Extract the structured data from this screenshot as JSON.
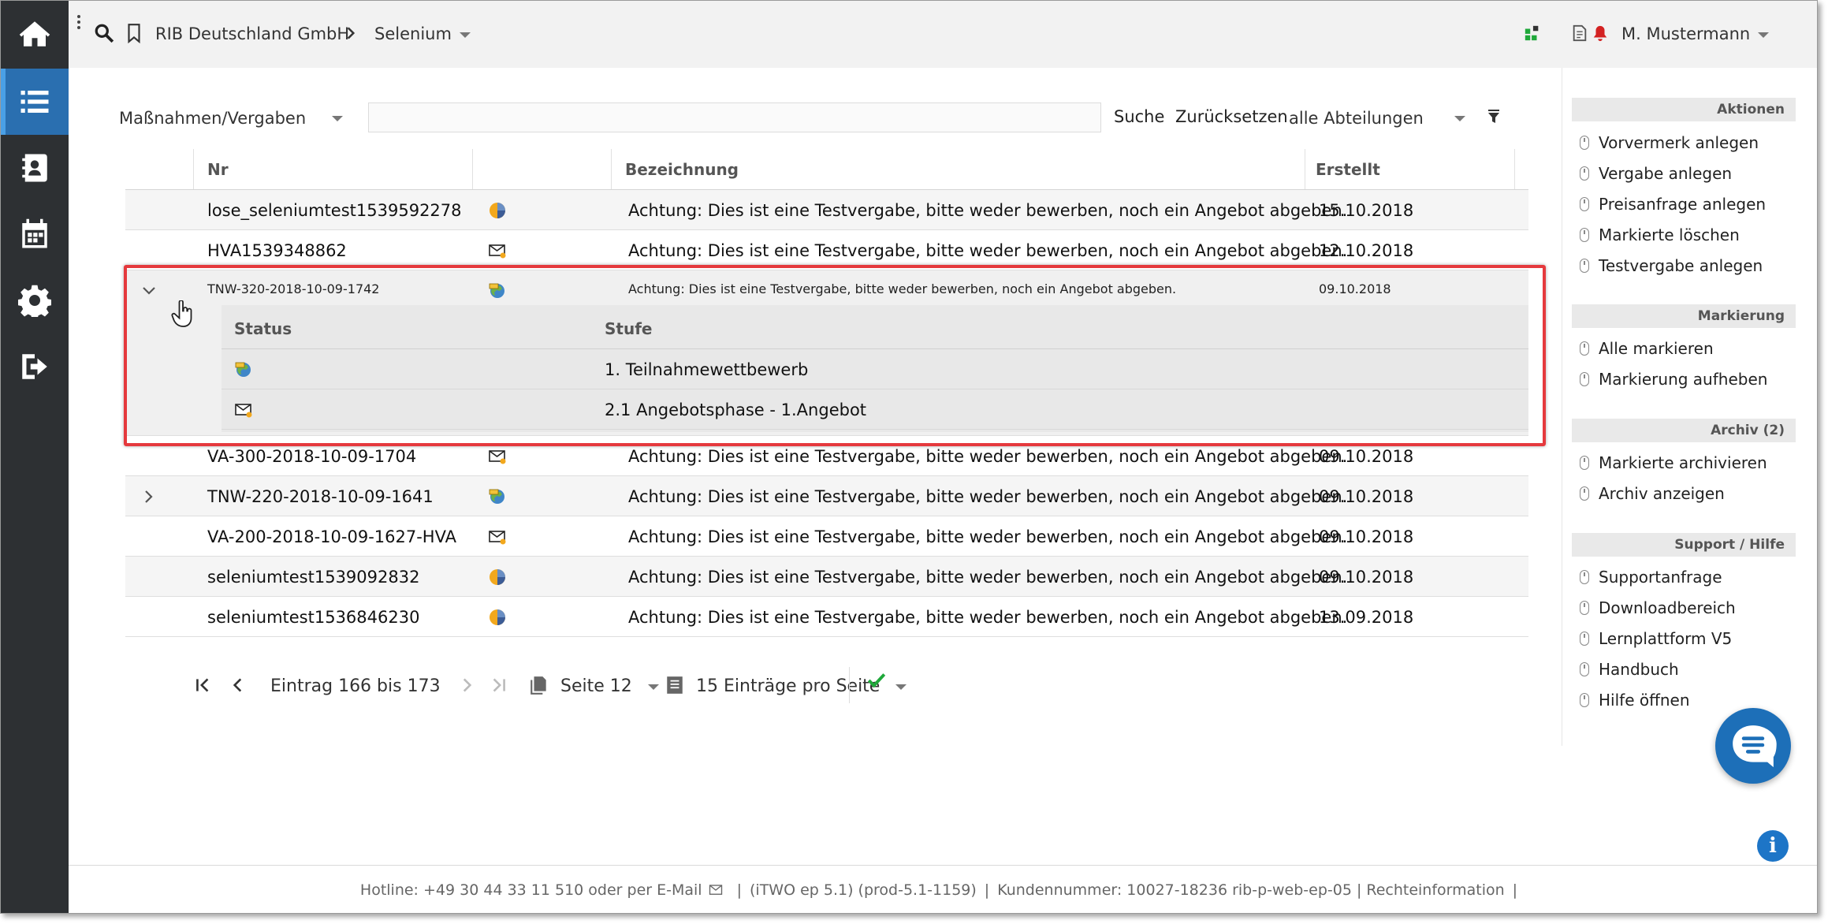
{
  "topbar": {
    "company": "RIB Deutschland GmbH",
    "project": "Selenium",
    "user": "M. Mustermann"
  },
  "filter": {
    "category": "Maßnahmen/Vergaben",
    "search_value": "",
    "search_button": "Suche",
    "reset_button": "Zurücksetzen",
    "department": "alle Abteilungen"
  },
  "table": {
    "headers": {
      "nr": "Nr",
      "bezeichnung": "Bezeichnung",
      "erstellt": "Erstellt"
    },
    "rows": [
      {
        "nr": "lose_seleniumtest1539592278",
        "status": "pie-icon",
        "bezeichnung": "Achtung: Dies ist eine Testvergabe, bitte weder bewerben, noch ein Angebot abgeben.",
        "erstellt": "15.10.2018"
      },
      {
        "nr": "HVA1539348862",
        "status": "envelope-icon",
        "bezeichnung": "Achtung: Dies ist eine Testvergabe, bitte weder bewerben, noch ein Angebot abgeben.",
        "erstellt": "12.10.2018"
      },
      {
        "nr": "TNW-320-2018-10-09-1742",
        "status": "globe-icon",
        "bezeichnung": "Achtung: Dies ist eine Testvergabe, bitte weder bewerben, noch ein Angebot abgeben.",
        "erstellt": "09.10.2018"
      },
      {
        "nr": "VA-300-2018-10-09-1704",
        "status": "envelope-icon",
        "bezeichnung": "Achtung: Dies ist eine Testvergabe, bitte weder bewerben, noch ein Angebot abgeben.",
        "erstellt": "09.10.2018"
      },
      {
        "nr": "TNW-220-2018-10-09-1641",
        "status": "globe-icon",
        "bezeichnung": "Achtung: Dies ist eine Testvergabe, bitte weder bewerben, noch ein Angebot abgeben.",
        "erstellt": "09.10.2018"
      },
      {
        "nr": "VA-200-2018-10-09-1627-HVA",
        "status": "envelope-icon",
        "bezeichnung": "Achtung: Dies ist eine Testvergabe, bitte weder bewerben, noch ein Angebot abgeben.",
        "erstellt": "09.10.2018"
      },
      {
        "nr": "seleniumtest1539092832",
        "status": "pie-icon",
        "bezeichnung": "Achtung: Dies ist eine Testvergabe, bitte weder bewerben, noch ein Angebot abgeben.",
        "erstellt": "09.10.2018"
      },
      {
        "nr": "seleniumtest1536846230",
        "status": "pie-icon",
        "bezeichnung": "Achtung: Dies ist eine Testvergabe, bitte weder bewerben, noch ein Angebot abgeben.",
        "erstellt": "13.09.2018"
      }
    ],
    "expanded": {
      "headers": {
        "status": "Status",
        "stufe": "Stufe"
      },
      "rows": [
        {
          "status": "globe-icon",
          "stufe": "1. Teilnahmewettbewerb"
        },
        {
          "status": "envelope-icon",
          "stufe": "2.1 Angebotsphase - 1.Angebot"
        }
      ]
    }
  },
  "pager": {
    "range": "Eintrag 166 bis 173",
    "page": "Seite 12",
    "per_page": "15 Einträge pro Seite"
  },
  "sidebar": {
    "sections": [
      {
        "title": "Aktionen",
        "items": [
          "Vorvermerk anlegen",
          "Vergabe anlegen",
          "Preisanfrage anlegen",
          "Markierte löschen",
          "Testvergabe anlegen"
        ]
      },
      {
        "title": "Markierung",
        "items": [
          "Alle markieren",
          "Markierung aufheben"
        ]
      },
      {
        "title": "Archiv (2)",
        "items": [
          "Markierte archivieren",
          "Archiv anzeigen"
        ]
      },
      {
        "title": "Support / Hilfe",
        "items": [
          "Supportanfrage",
          "Downloadbereich",
          "Lernplattform V5",
          "Handbuch",
          "Hilfe öffnen"
        ]
      }
    ]
  },
  "footer": {
    "hotline": "Hotline: +49 30 44 33 11 510 oder per E-Mail",
    "version": "(iTWO ep 5.1) (prod-5.1-1159)",
    "customer": "Kundennummer: 10027-18236 rib-p-web-ep-05",
    "legal": "Rechteinformation"
  },
  "colors": {
    "nav_bg": "#2d3033",
    "nav_active": "#2a6fb0",
    "highlight": "#e5393d",
    "chat": "#1d6fb8",
    "check": "#1fa83a"
  }
}
